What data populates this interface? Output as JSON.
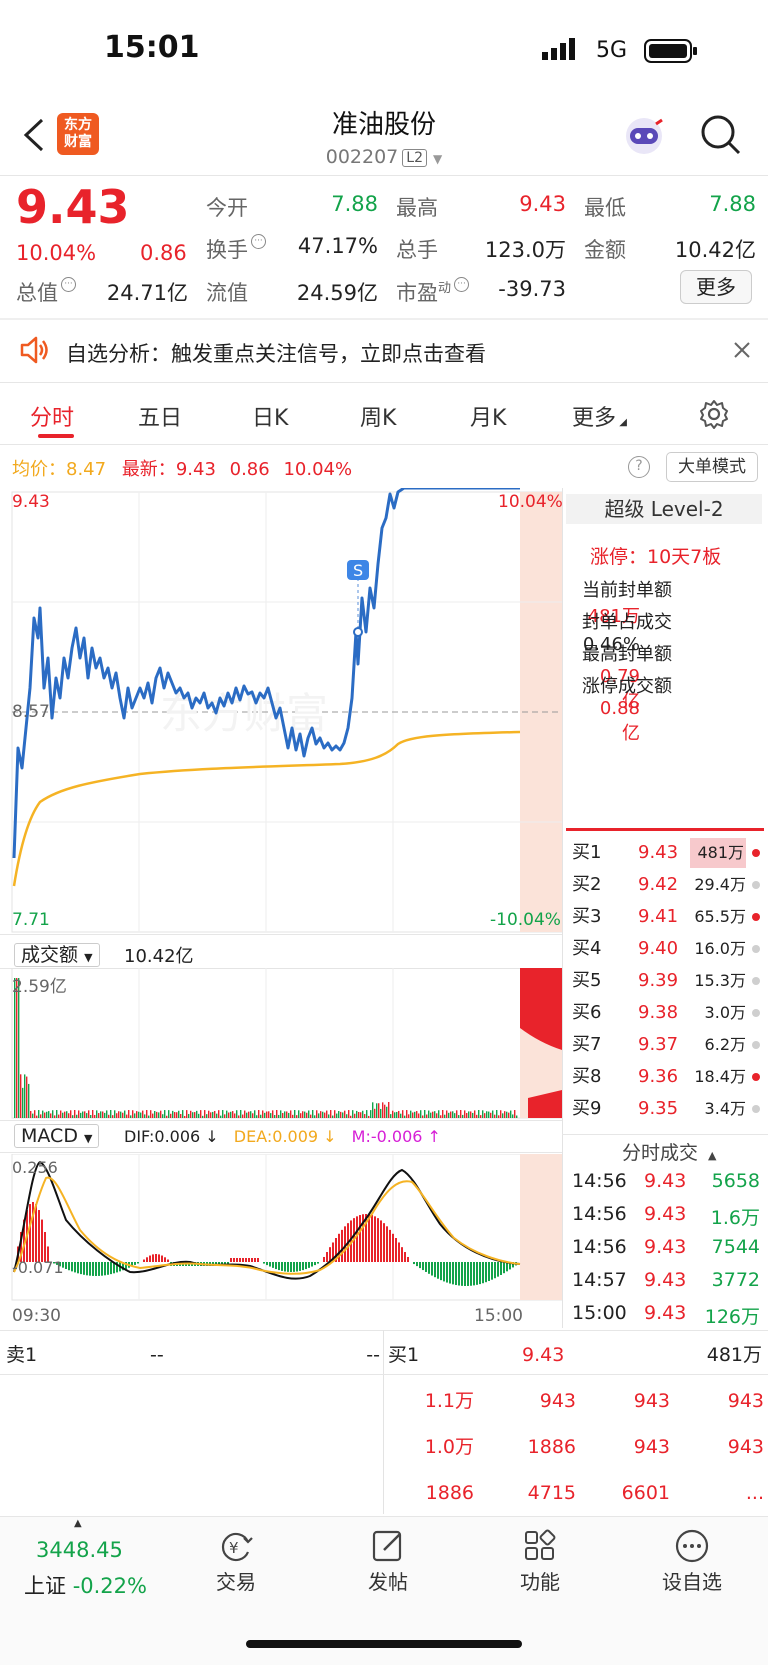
{
  "status": {
    "time": "15:01",
    "network": "5G"
  },
  "header": {
    "logo_text": "东方\n财富",
    "title": "准油股份",
    "code": "002207",
    "level": "L2"
  },
  "quote": {
    "price": "9.43",
    "change_pct": "10.04%",
    "change": "0.86",
    "open_label": "今开",
    "open": "7.88",
    "high_label": "最高",
    "high": "9.43",
    "low_label": "最低",
    "low": "7.88",
    "turnover_label": "换手",
    "turnover": "47.17%",
    "volume_label": "总手",
    "volume": "123.0万",
    "amount_label": "金额",
    "amount": "10.42亿",
    "mktcap_label": "总值",
    "mktcap": "24.71亿",
    "float_label": "流值",
    "float": "24.59亿",
    "pe_label": "市盈",
    "pe_sup": "动",
    "pe": "-39.73",
    "more": "更多"
  },
  "notice": {
    "text": "自选分析：触发重点关注信号，立即点击查看"
  },
  "tabs": [
    "分时",
    "五日",
    "日K",
    "周K",
    "月K",
    "更多"
  ],
  "legend": {
    "avg_label": "均价：",
    "avg": "8.47",
    "latest_label": "最新：",
    "latest": "9.43",
    "chg": "0.86",
    "pct": "10.04%",
    "big_order": "大单模式"
  },
  "chart_labels": {
    "top_price": "9.43",
    "top_pct": "10.04%",
    "mid_price": "8.57",
    "bottom_price": "7.71",
    "bottom_pct": "-10.04%",
    "s_marker": "S",
    "watermark": "东方财富",
    "time_start": "09:30",
    "time_end": "15:00"
  },
  "volume_panel": {
    "label": "成交额",
    "total": "10.42亿",
    "max": "2.59亿"
  },
  "macd_panel": {
    "label": "MACD",
    "dif": "DIF:0.006 ↓",
    "dea": "DEA:0.009 ↓",
    "m": "M:-0.006 ↑",
    "top": "0.256",
    "bottom": "-0.071"
  },
  "level2": {
    "title": "超级 Level-2",
    "limit_up": "涨停：10天7板",
    "rows": [
      {
        "label": "当前封单额",
        "value": "481万"
      },
      {
        "label": "封单占成交",
        "value": "0.46%"
      },
      {
        "label": "最高封单额",
        "value": "0.79亿"
      },
      {
        "label": "涨停成交额",
        "value": "0.88亿"
      }
    ]
  },
  "orderbook": [
    {
      "label": "买1",
      "price": "9.43",
      "vol": "481万"
    },
    {
      "label": "买2",
      "price": "9.42",
      "vol": "29.4万"
    },
    {
      "label": "买3",
      "price": "9.41",
      "vol": "65.5万"
    },
    {
      "label": "买4",
      "price": "9.40",
      "vol": "16.0万"
    },
    {
      "label": "买5",
      "price": "9.39",
      "vol": "15.3万"
    },
    {
      "label": "买6",
      "price": "9.38",
      "vol": "3.0万"
    },
    {
      "label": "买7",
      "price": "9.37",
      "vol": "6.2万"
    },
    {
      "label": "买8",
      "price": "9.36",
      "vol": "18.4万"
    },
    {
      "label": "买9",
      "price": "9.35",
      "vol": "3.4万"
    }
  ],
  "trades": {
    "title": "分时成交",
    "rows": [
      {
        "time": "14:56",
        "price": "9.43",
        "vol": "5658"
      },
      {
        "time": "14:56",
        "price": "9.43",
        "vol": "1.6万"
      },
      {
        "time": "14:56",
        "price": "9.43",
        "vol": "7544"
      },
      {
        "time": "14:57",
        "price": "9.43",
        "vol": "3772"
      },
      {
        "time": "15:00",
        "price": "9.43",
        "vol": "126万"
      }
    ]
  },
  "sell_side": {
    "label": "卖1",
    "price": "--",
    "vol": "--"
  },
  "buy_side": {
    "label": "买1",
    "price": "9.43",
    "vol": "481万",
    "queue": [
      [
        "1.1万",
        "943",
        "943",
        "943"
      ],
      [
        "1.0万",
        "1886",
        "943",
        "943"
      ],
      [
        "1886",
        "4715",
        "6601",
        "..."
      ]
    ]
  },
  "nav": {
    "index_value": "3448.45",
    "index_name": "上证",
    "index_pct": "-0.22%",
    "items": [
      "交易",
      "发帖",
      "功能",
      "设自选"
    ]
  }
}
